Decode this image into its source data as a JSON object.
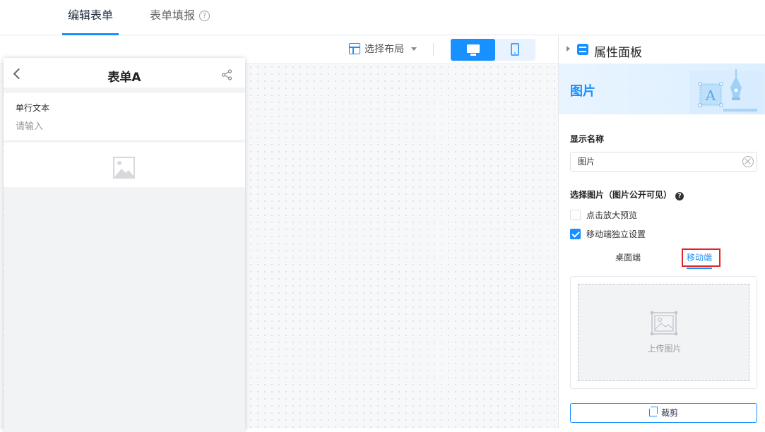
{
  "top_tabs": [
    {
      "label": "编辑表单",
      "active": true
    },
    {
      "label": "表单填报",
      "active": false
    }
  ],
  "toolbar": {
    "layout_label": "选择布局",
    "active_device": "desktop"
  },
  "preview": {
    "title": "表单A",
    "field_label": "单行文本",
    "field_placeholder": "请输入"
  },
  "panel": {
    "title": "属性面板",
    "component_title": "图片",
    "display_name_label": "显示名称",
    "display_name_value": "图片",
    "select_image_label": "选择图片（图片公开可见）",
    "help_glyph": "?",
    "checkboxes": [
      {
        "label": "点击放大预览",
        "checked": false
      },
      {
        "label": "移动端独立设置",
        "checked": true
      }
    ],
    "sub_tabs": [
      {
        "label": "桌面端",
        "active": false
      },
      {
        "label": "移动端",
        "active": true
      }
    ],
    "upload_label": "上传图片",
    "crop_label": "裁剪"
  },
  "colors": {
    "accent": "#1890ff",
    "highlight_box": "#e0242c"
  }
}
